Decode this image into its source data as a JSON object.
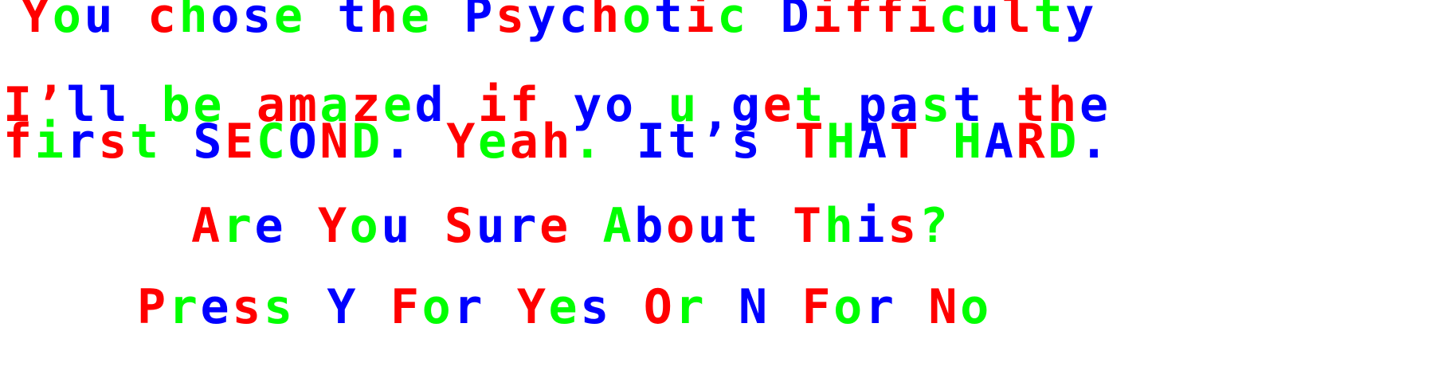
{
  "colors": {
    "r": "#ff0000",
    "g": "#00ff00",
    "b": "#0000ff",
    "background": "#ffffff"
  },
  "screen": {
    "lines": [
      {
        "id": "difficulty-line",
        "runs": [
          [
            "r",
            "Y"
          ],
          [
            "g",
            "o"
          ],
          [
            "b",
            "u"
          ],
          [
            "g",
            " "
          ],
          [
            "r",
            "c"
          ],
          [
            "g",
            "h"
          ],
          [
            "b",
            "o"
          ],
          [
            "b",
            "s"
          ],
          [
            "g",
            "e"
          ],
          [
            "g",
            " "
          ],
          [
            "b",
            "t"
          ],
          [
            "r",
            "h"
          ],
          [
            "g",
            "e"
          ],
          [
            "g",
            " "
          ],
          [
            "b",
            "P"
          ],
          [
            "r",
            "s"
          ],
          [
            "b",
            "y"
          ],
          [
            "b",
            "c"
          ],
          [
            "r",
            "h"
          ],
          [
            "g",
            "o"
          ],
          [
            "b",
            "t"
          ],
          [
            "r",
            "i"
          ],
          [
            "g",
            "c"
          ],
          [
            "g",
            " "
          ],
          [
            "b",
            "D"
          ],
          [
            "r",
            "i"
          ],
          [
            "r",
            "f"
          ],
          [
            "r",
            "f"
          ],
          [
            "r",
            "i"
          ],
          [
            "g",
            "c"
          ],
          [
            "b",
            "u"
          ],
          [
            "r",
            "l"
          ],
          [
            "g",
            "t"
          ],
          [
            "b",
            "y"
          ]
        ]
      },
      {
        "id": "taunt-line-1",
        "runs": [
          [
            "r",
            "I"
          ],
          [
            "r",
            "’"
          ],
          [
            "b",
            "l"
          ],
          [
            "b",
            "l"
          ],
          [
            "g",
            " "
          ],
          [
            "g",
            "b"
          ],
          [
            "g",
            "e"
          ],
          [
            "g",
            " "
          ],
          [
            "r",
            "a"
          ],
          [
            "r",
            "m"
          ],
          [
            "g",
            "a"
          ],
          [
            "r",
            "z"
          ],
          [
            "g",
            "e"
          ],
          [
            "b",
            "d"
          ],
          [
            "g",
            " "
          ],
          [
            "r",
            "i"
          ],
          [
            "r",
            "f"
          ],
          [
            "g",
            " "
          ],
          [
            "b",
            "y"
          ],
          [
            "b",
            "o"
          ],
          [
            "g",
            " "
          ],
          [
            "g",
            "u"
          ],
          [
            "g",
            " "
          ],
          [
            "b",
            "g"
          ],
          [
            "r",
            "e"
          ],
          [
            "g",
            "t"
          ],
          [
            "g",
            " "
          ],
          [
            "b",
            "p"
          ],
          [
            "b",
            "a"
          ],
          [
            "g",
            "s"
          ],
          [
            "b",
            "t"
          ],
          [
            "g",
            " "
          ],
          [
            "r",
            "t"
          ],
          [
            "r",
            "h"
          ],
          [
            "b",
            "e"
          ]
        ]
      },
      {
        "id": "taunt-line-2",
        "runs": [
          [
            "r",
            "f"
          ],
          [
            "g",
            "i"
          ],
          [
            "b",
            "r"
          ],
          [
            "r",
            "s"
          ],
          [
            "g",
            "t"
          ],
          [
            "g",
            " "
          ],
          [
            "b",
            "S"
          ],
          [
            "r",
            "E"
          ],
          [
            "g",
            "C"
          ],
          [
            "b",
            "O"
          ],
          [
            "r",
            "N"
          ],
          [
            "g",
            "D"
          ],
          [
            "b",
            "."
          ],
          [
            "g",
            " "
          ],
          [
            "r",
            "Y"
          ],
          [
            "g",
            "e"
          ],
          [
            "r",
            "a"
          ],
          [
            "r",
            "h"
          ],
          [
            "g",
            "."
          ],
          [
            "g",
            " "
          ],
          [
            "b",
            "I"
          ],
          [
            "b",
            "t"
          ],
          [
            "b",
            "’"
          ],
          [
            "b",
            "s"
          ],
          [
            "g",
            " "
          ],
          [
            "r",
            "T"
          ],
          [
            "g",
            "H"
          ],
          [
            "b",
            "A"
          ],
          [
            "r",
            "T"
          ],
          [
            "g",
            " "
          ],
          [
            "g",
            "H"
          ],
          [
            "b",
            "A"
          ],
          [
            "r",
            "R"
          ],
          [
            "g",
            "D"
          ],
          [
            "b",
            "."
          ]
        ]
      },
      {
        "id": "confirm-question",
        "runs": [
          [
            "r",
            "A"
          ],
          [
            "g",
            "r"
          ],
          [
            "b",
            "e"
          ],
          [
            "g",
            " "
          ],
          [
            "r",
            "Y"
          ],
          [
            "g",
            "o"
          ],
          [
            "b",
            "u"
          ],
          [
            "g",
            " "
          ],
          [
            "r",
            "S"
          ],
          [
            "b",
            "u"
          ],
          [
            "b",
            "r"
          ],
          [
            "r",
            "e"
          ],
          [
            "g",
            " "
          ],
          [
            "g",
            "A"
          ],
          [
            "b",
            "b"
          ],
          [
            "r",
            "o"
          ],
          [
            "b",
            "u"
          ],
          [
            "b",
            "t"
          ],
          [
            "g",
            " "
          ],
          [
            "r",
            "T"
          ],
          [
            "g",
            "h"
          ],
          [
            "b",
            "i"
          ],
          [
            "r",
            "s"
          ],
          [
            "g",
            "?"
          ]
        ]
      },
      {
        "id": "key-prompt",
        "runs": [
          [
            "r",
            "P"
          ],
          [
            "g",
            "r"
          ],
          [
            "b",
            "e"
          ],
          [
            "r",
            "s"
          ],
          [
            "g",
            "s"
          ],
          [
            "g",
            " "
          ],
          [
            "b",
            "Y"
          ],
          [
            "g",
            " "
          ],
          [
            "r",
            "F"
          ],
          [
            "g",
            "o"
          ],
          [
            "b",
            "r"
          ],
          [
            "g",
            " "
          ],
          [
            "r",
            "Y"
          ],
          [
            "g",
            "e"
          ],
          [
            "b",
            "s"
          ],
          [
            "g",
            " "
          ],
          [
            "r",
            "O"
          ],
          [
            "g",
            "r"
          ],
          [
            "g",
            " "
          ],
          [
            "b",
            "N"
          ],
          [
            "g",
            " "
          ],
          [
            "r",
            "F"
          ],
          [
            "g",
            "o"
          ],
          [
            "b",
            "r"
          ],
          [
            "g",
            " "
          ],
          [
            "r",
            "N"
          ],
          [
            "g",
            "o"
          ]
        ]
      }
    ]
  }
}
